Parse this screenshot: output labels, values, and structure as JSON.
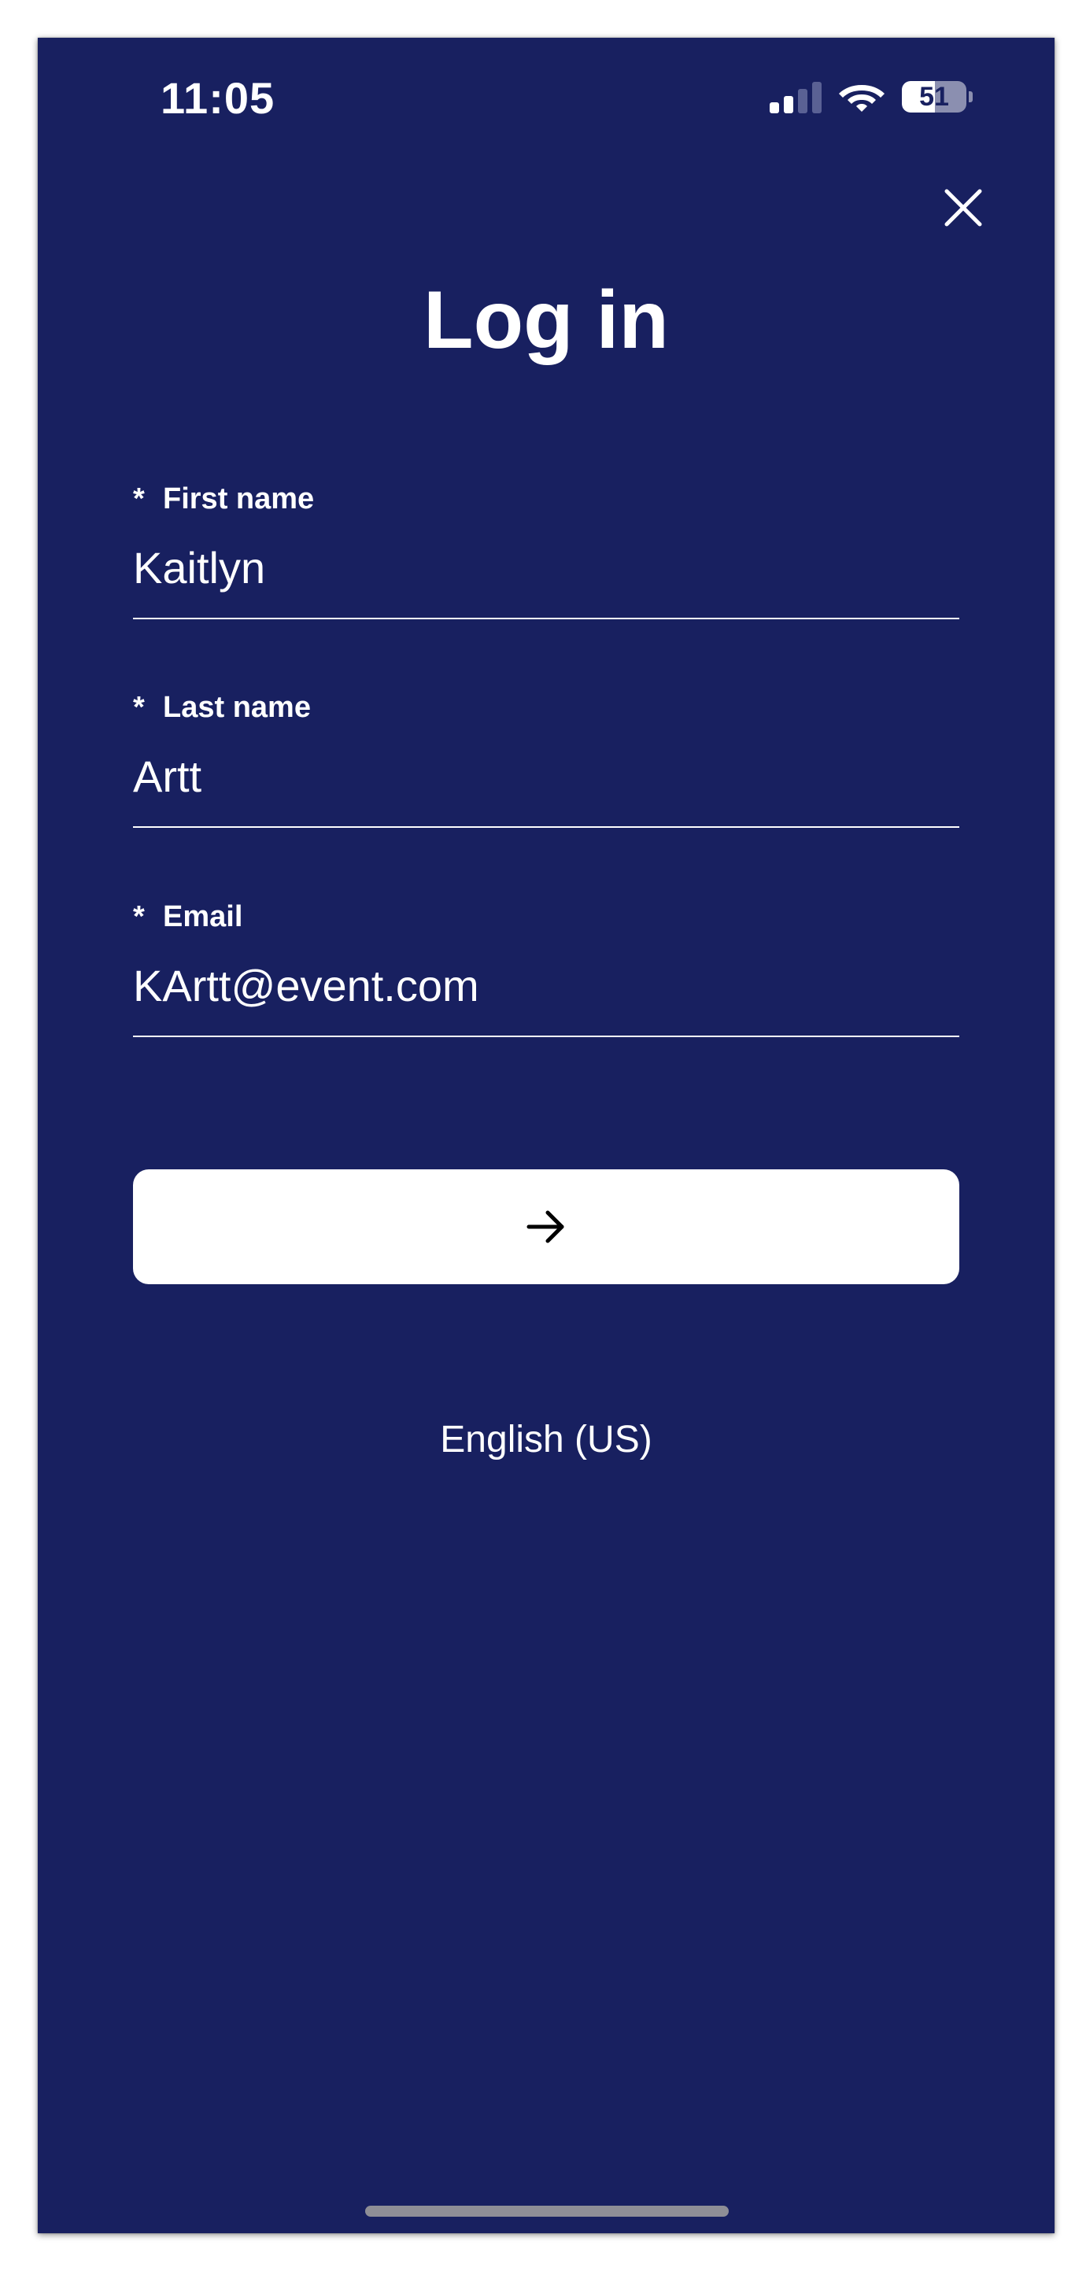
{
  "status_bar": {
    "time": "11:05",
    "signal_bars_active": 2,
    "signal_bars_total": 4,
    "battery_level": 51,
    "icons": [
      "cellular-signal-icon",
      "wifi-icon",
      "battery-icon"
    ]
  },
  "header": {
    "close_icon": "close-icon",
    "title": "Log in"
  },
  "form": {
    "required_marker": "*",
    "first_name": {
      "label": "First name",
      "value": "Kaitlyn"
    },
    "last_name": {
      "label": "Last name",
      "value": "Artt"
    },
    "email": {
      "label": "Email",
      "value": "KArtt@event.com"
    },
    "submit_icon": "arrow-right-icon"
  },
  "footer": {
    "language": "English (US)"
  },
  "colors": {
    "background": "#182060",
    "text": "#ffffff",
    "button_bg": "#ffffff",
    "button_icon": "#000000",
    "home_indicator": "#8e8e96"
  }
}
